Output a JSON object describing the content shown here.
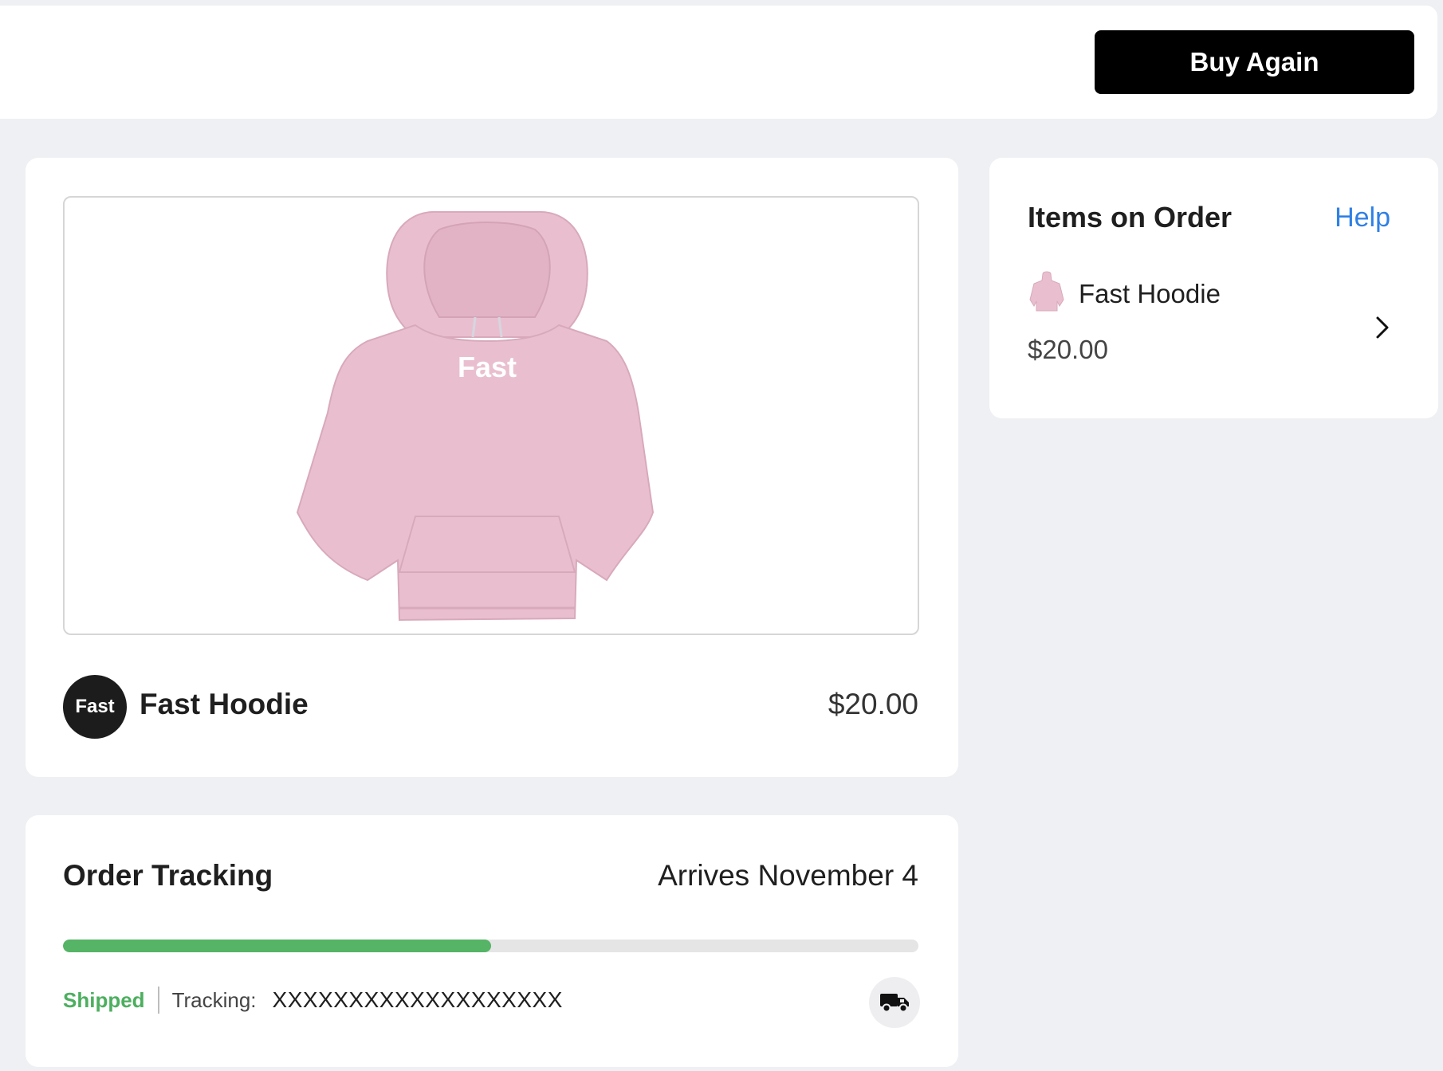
{
  "header": {
    "buy_again_label": "Buy Again"
  },
  "product": {
    "image_print_text": "Fast",
    "brand_logo_text": "Fast",
    "name": "Fast Hoodie",
    "price": "$20.00"
  },
  "tracking": {
    "title": "Order Tracking",
    "arrival": "Arrives November 4",
    "progress_fraction": 0.5,
    "status": "Shipped",
    "tracking_label": "Tracking:",
    "tracking_number": "XXXXXXXXXXXXXXXXXXX",
    "truck_icon": "truck-icon"
  },
  "items_panel": {
    "title": "Items on Order",
    "help_label": "Help",
    "items": [
      {
        "name": "Fast Hoodie",
        "price": "$20.00"
      }
    ]
  },
  "colors": {
    "page_background": "#eff0f4",
    "primary_button": "#000000",
    "progress_fill": "#55b466",
    "status_shipped": "#4caf5f",
    "link": "#2f80e4",
    "hoodie": "#e9bfcf"
  }
}
